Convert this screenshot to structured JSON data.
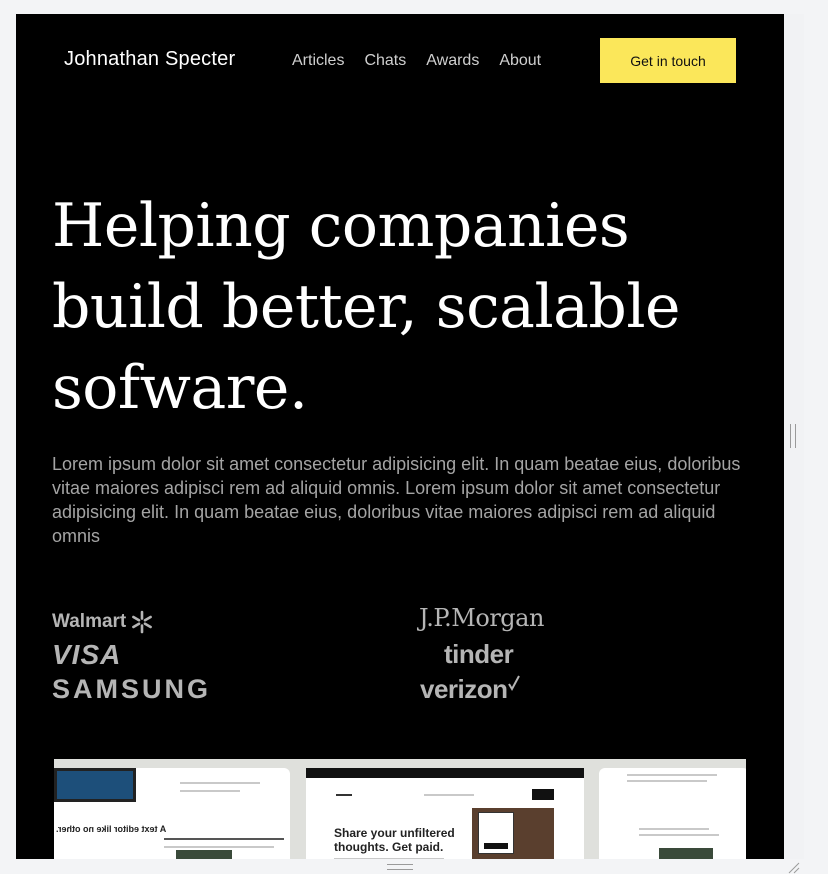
{
  "header": {
    "brand": "Johnathan Specter",
    "nav": [
      "Articles",
      "Chats",
      "Awards",
      "About"
    ],
    "cta_label": "Get in touch"
  },
  "hero": {
    "title_lines": [
      "Helping companies",
      "build better, scalable",
      "sofware."
    ],
    "description": "Lorem ipsum dolor sit amet consectetur adipisicing elit. In quam beatae eius, doloribus vitae maiores adipisci rem ad aliquid omnis. Lorem ipsum dolor sit amet consectetur adipisicing elit. In quam beatae eius, doloribus vitae maiores adipisci rem ad aliquid omnis"
  },
  "logos": {
    "walmart": "Walmart",
    "visa": "VISA",
    "samsung": "SAMSUNG",
    "jpmorgan": "J.P.Morgan",
    "tinder": "tinder",
    "verizon": "verizon"
  },
  "preview": {
    "mid_heading_lines": [
      "Share your unfiltered",
      "thoughts. Get paid."
    ],
    "left_title": "A text editor like no other."
  },
  "colors": {
    "background": "#000000",
    "accent": "#fbe75a",
    "logo_gray": "#b5b5b5",
    "body_text": "#a4a4a4"
  }
}
